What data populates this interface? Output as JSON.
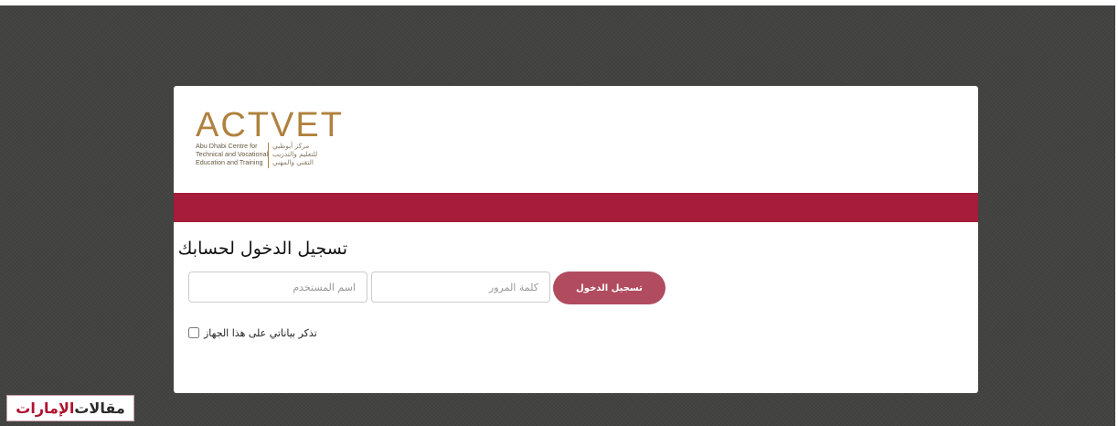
{
  "logo": {
    "wordmark": "ACTVET",
    "english_lines": [
      "Abu Dhabi Centre for",
      "Technical and Vocational",
      "Education and Training"
    ],
    "arabic_lines": [
      "مركز أبوظبي",
      "للتعليم والتدريب",
      "التقني والمهني"
    ],
    "color": "#b0823e"
  },
  "band": {
    "color": "#a71c3b"
  },
  "form": {
    "title": "تسجيل الدخول لحسابك",
    "username_placeholder": "اسم المستخدم",
    "password_placeholder": "كلمة المرور",
    "login_label": "تسجيل الدخول",
    "login_color": "#b04b60",
    "remember_label": "تذكر بياناتي على هذا الجهاز",
    "remember_checked": false
  },
  "watermark": {
    "part1": "مقالات",
    "part2": "الإمارات"
  }
}
